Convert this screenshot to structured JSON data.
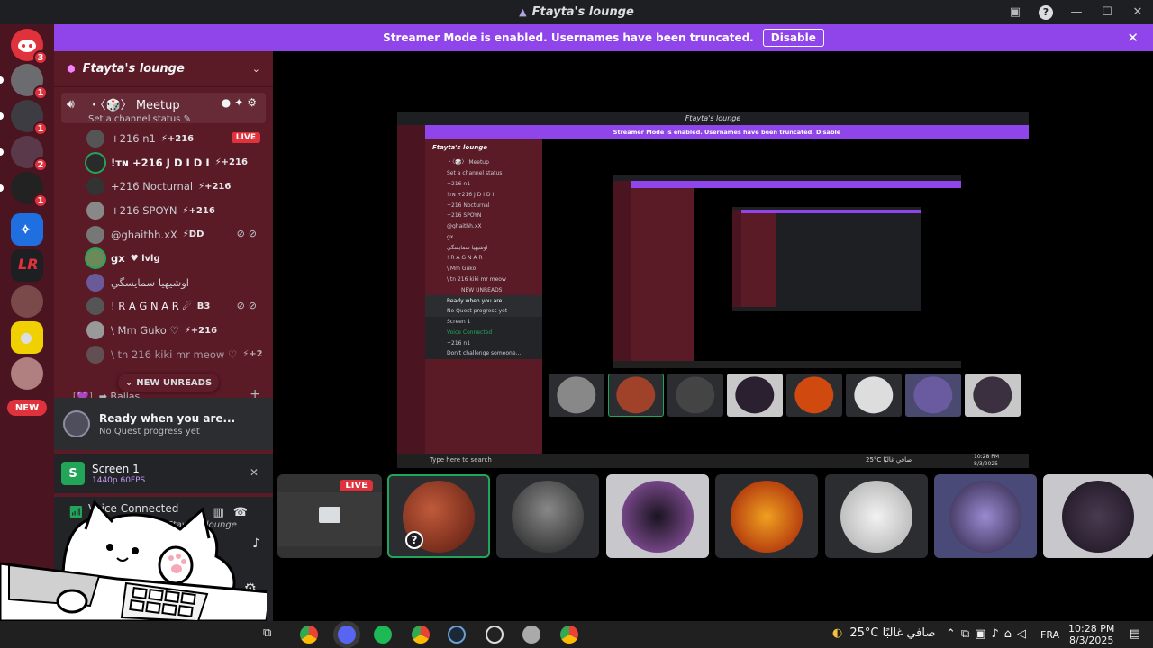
{
  "window": {
    "title": "Ftayta's lounge"
  },
  "banner": {
    "text": "Streamer Mode is enabled. Usernames have been truncated.",
    "button": "Disable"
  },
  "rail": {
    "badges": [
      "3",
      "1",
      "1",
      "2",
      "1"
    ],
    "new_label": "NEW"
  },
  "sidebar": {
    "server_name": "Ftayta's lounge",
    "voice_channel": {
      "name": "・〈🎲〉 Meetup",
      "status": "Set a channel status"
    },
    "members": [
      {
        "name": "+216 n1",
        "tag": "⚡+216",
        "live": "LIVE"
      },
      {
        "name": "!тɴ +216 J D I D I",
        "tag": "⚡+216"
      },
      {
        "name": "+216 Nocturnal",
        "tag": "⚡+216"
      },
      {
        "name": "+216 SPOYN",
        "tag": "⚡+216"
      },
      {
        "name": "@ghaithh.xX",
        "tag": "⚡DD"
      },
      {
        "name": "gx",
        "tag": "♥ lvlg"
      },
      {
        "name": "اوشيهيا سمايسگي"
      },
      {
        "name": "! R A G N A R ☄",
        "tag": "B3"
      },
      {
        "name": "\\ Mm Guko ♡",
        "tag": "⚡+216"
      },
      {
        "name": "\\ tn 216 kiki mr meow ♡",
        "tag": "⚡+2"
      }
    ],
    "new_unreads": "NEW UNREADS",
    "category": "〔💜〕➡ Ballas"
  },
  "quest": {
    "title": "Ready when you are...",
    "subtitle": "No Quest progress yet"
  },
  "screen": {
    "name": "Screen 1",
    "quality": "1440p 60FPS"
  },
  "voice": {
    "status": "Voice Connected",
    "channel": "・〈🎲〉 Meetup / Ftayta's lounge"
  },
  "inner_screen": {
    "title": "Ftayta's lounge",
    "banner": "Streamer Mode is enabled. Usernames have been truncated.   Disable",
    "server": "Ftayta's lounge",
    "lines": [
      "・〈🎲〉 Meetup",
      "Set a channel status",
      "+216 n1",
      "!тɴ +216 J D I D I",
      "+216 Nocturnal",
      "+216 SPOYN",
      "@ghaithh.xX",
      "gx",
      "اوشيهيا سمايسگي",
      "! R A G N A R",
      "\\ Mm Guko",
      "\\ tn 216 kiki mr meow",
      "NEW UNREADS",
      "Ready when you are...",
      "No Quest progress yet",
      "Screen 1",
      "Voice Connected",
      "+216 n1",
      "Don't challenge someone..."
    ],
    "search": "Type here to search",
    "weather": "25°C صافي غالبًا",
    "time": "10:28 PM",
    "date": "8/3/2025"
  },
  "tiles": {
    "live_label": "LIVE",
    "help_glyph": "?"
  },
  "taskbar": {
    "weather": "25°C صافي غالبًا",
    "lang": "FRA",
    "time": "10:28 PM",
    "date": "8/3/2025"
  },
  "colors": {
    "accent": "#8f45e9",
    "sidebar": "#5a1a26",
    "rail": "#4a1420",
    "live": "#e0323c",
    "online": "#23a559"
  }
}
